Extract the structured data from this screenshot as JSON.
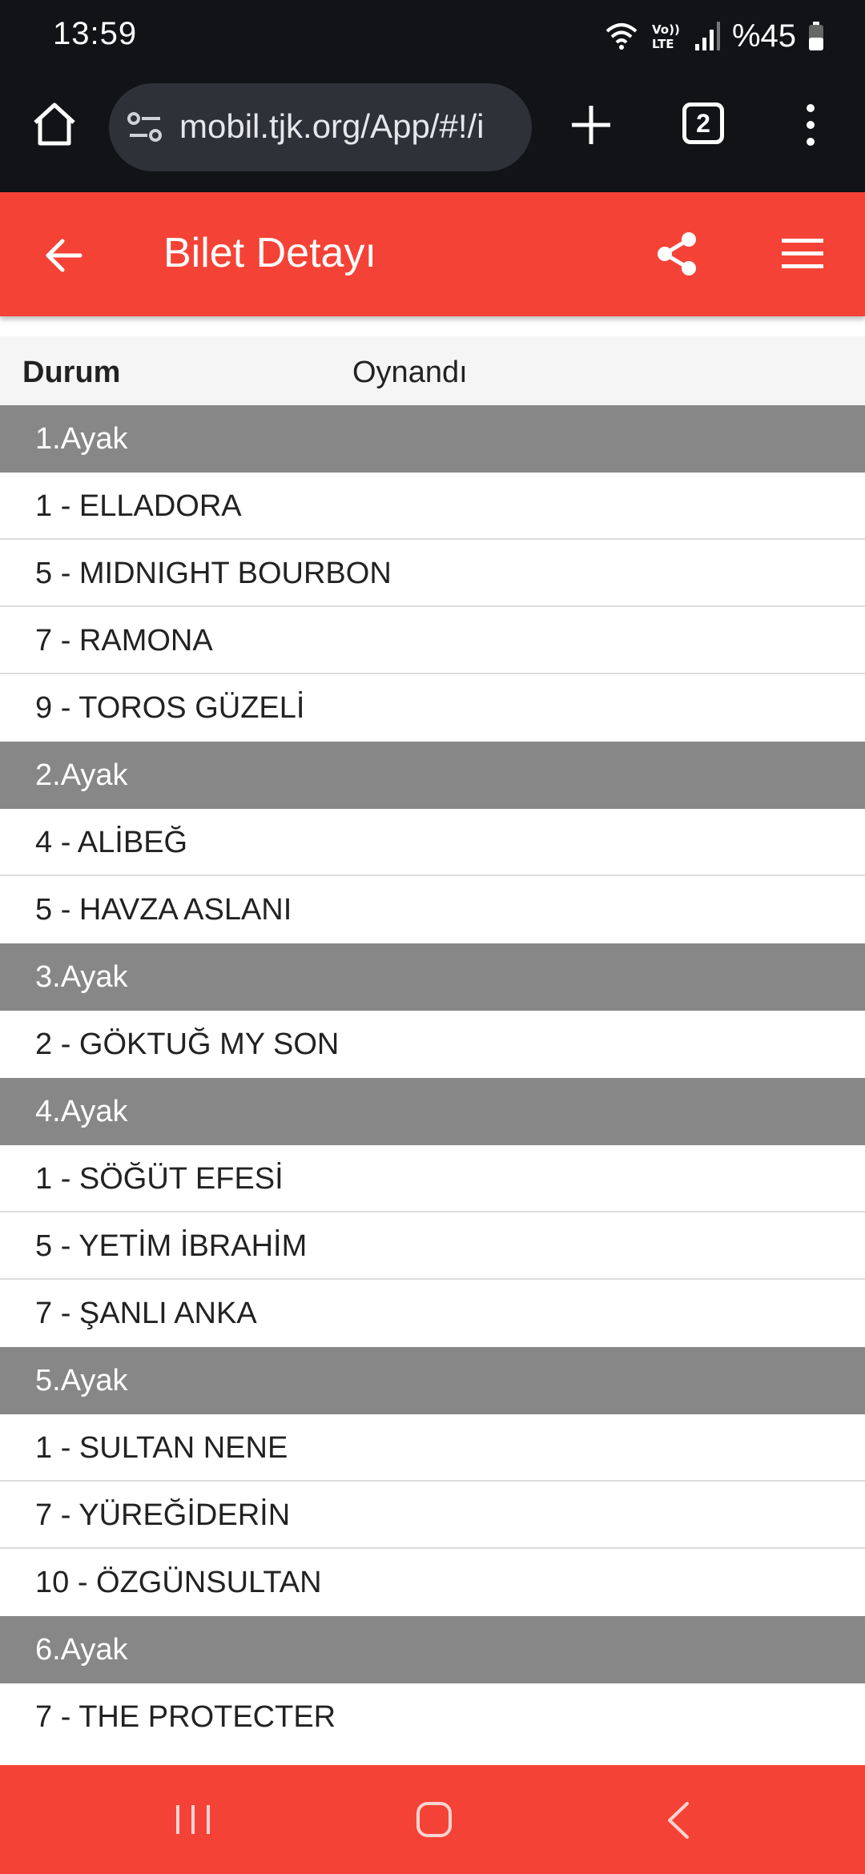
{
  "status_bar": {
    "time": "13:59",
    "battery_text": "%45",
    "icons": [
      "wifi-icon",
      "volte-icon",
      "signal-icon",
      "battery-icon"
    ]
  },
  "browser": {
    "url": "mobil.tjk.org/App/#!/i",
    "tab_count": "2"
  },
  "header": {
    "title": "Bilet Detayı",
    "background": "#f44336"
  },
  "ticket": {
    "status_label": "Durum",
    "status_value": "Oynandı",
    "legs": [
      {
        "title": "1.Ayak",
        "horses": [
          "1 - ELLADORA",
          "5 - MIDNIGHT BOURBON",
          "7 - RAMONA",
          "9 - TOROS GÜZELİ"
        ]
      },
      {
        "title": "2.Ayak",
        "horses": [
          "4 - ALİBEĞ",
          "5 - HAVZA ASLANI"
        ]
      },
      {
        "title": "3.Ayak",
        "horses": [
          "2 - GÖKTUĞ MY SON"
        ]
      },
      {
        "title": "4.Ayak",
        "horses": [
          "1 - SÖĞÜT EFESİ",
          "5 - YETİM İBRAHİM",
          "7 - ŞANLI ANKA"
        ]
      },
      {
        "title": "5.Ayak",
        "horses": [
          "1 - SULTAN NENE",
          "7 - YÜREĞİDERİN",
          "10 - ÖZGÜNSULTAN"
        ]
      },
      {
        "title": "6.Ayak",
        "horses": [
          "7 - THE PROTECTER"
        ]
      }
    ]
  }
}
